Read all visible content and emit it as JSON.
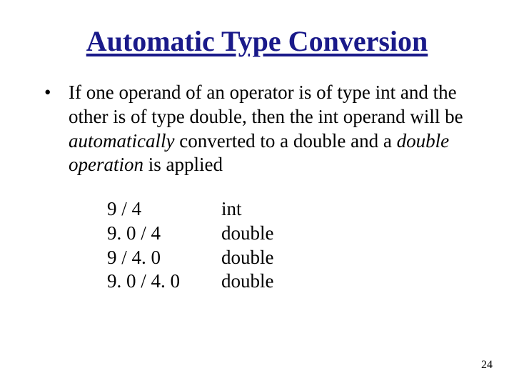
{
  "slide": {
    "title": "Automatic Type Conversion",
    "bullet_marker": "•",
    "para_part1": "If one operand of an operator is of type ",
    "para_int1": "int",
    "para_part2": " and the other is of type ",
    "para_dbl1": "double",
    "para_part3": ", then the ",
    "para_int2": "int",
    "para_part4": " operand will be ",
    "para_auto": "automatically",
    "para_part5": " converted to a ",
    "para_dbl2": "double",
    "para_part6": " and a ",
    "para_dop": "double operation",
    "para_part7": " is applied",
    "examples": {
      "expr": [
        "9 / 4",
        "9. 0 / 4",
        "9 / 4. 0",
        "9. 0 / 4. 0"
      ],
      "type": [
        "int",
        "double",
        "double",
        "double"
      ]
    },
    "page_number": "24"
  }
}
